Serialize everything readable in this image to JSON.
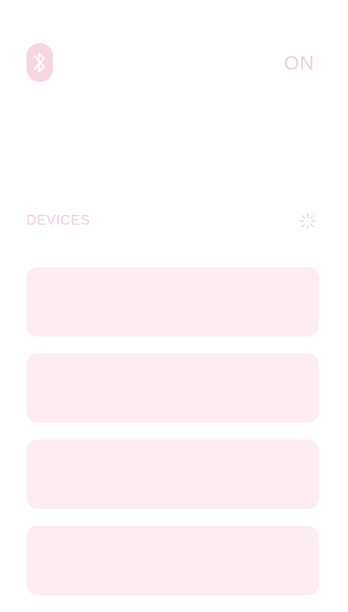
{
  "header": {
    "icon": "bluetooth-icon",
    "status_text": "ON"
  },
  "devices": {
    "title": "DEVICES",
    "loading_icon": "spinner-icon",
    "placeholder_cards": 4
  },
  "colors": {
    "icon_bg": "#f7d6e3",
    "text_muted_pink": "#f2cadb",
    "card_bg": "#fdedf3"
  }
}
